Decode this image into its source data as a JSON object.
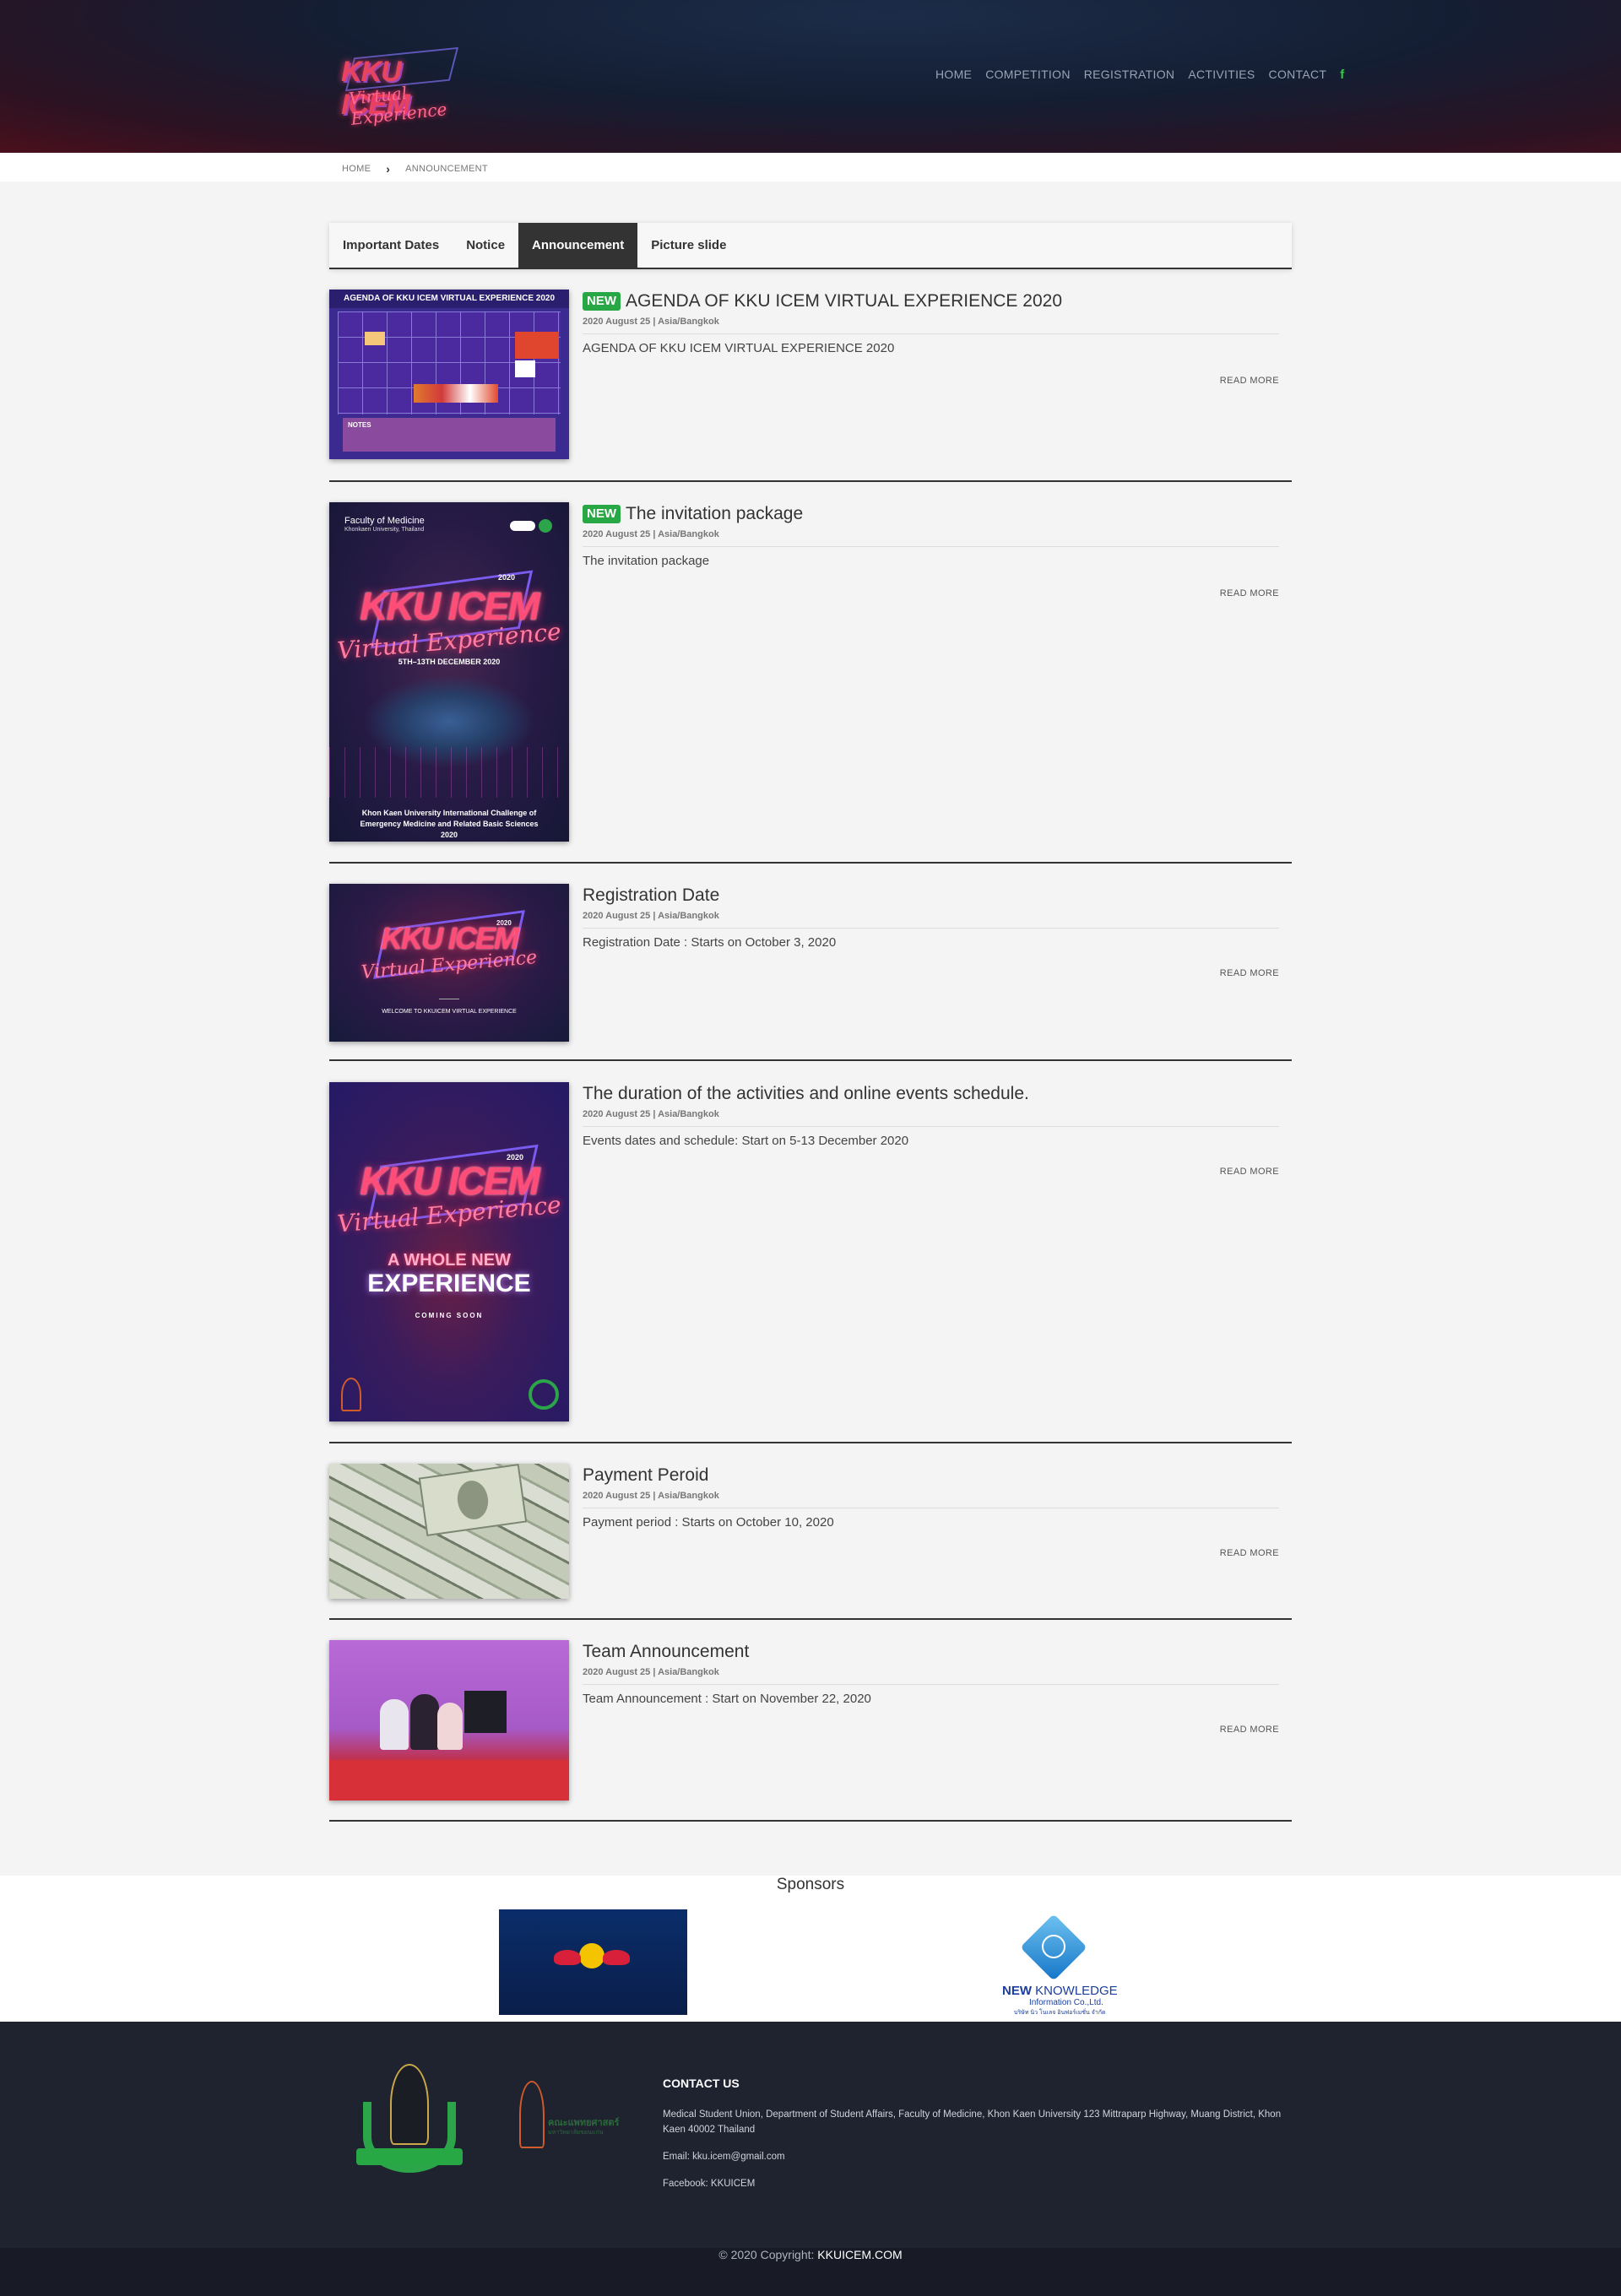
{
  "header": {
    "logo_line1": "KKU ICEM",
    "logo_line2": "Virtual Experience",
    "nav": [
      "HOME",
      "COMPETITION",
      "REGISTRATION",
      "ACTIVITIES",
      "CONTACT"
    ],
    "facebook_glyph": "f"
  },
  "breadcrumb": {
    "home": "HOME",
    "current": "ANNOUNCEMENT"
  },
  "tabs": [
    "Important Dates",
    "Notice",
    "Announcement",
    "Picture slide"
  ],
  "active_tab": "Announcement",
  "items": [
    {
      "badge": "NEW",
      "title": "AGENDA OF KKU ICEM VIRTUAL EXPERIENCE 2020",
      "meta": "2020 August 25 | Asia/Bangkok",
      "desc": "AGENDA OF KKU ICEM VIRTUAL EXPERIENCE 2020",
      "more": "READ MORE",
      "thumb_title": "AGENDA OF KKU ICEM VIRTUAL EXPERIENCE 2020",
      "thumb_notes": "NOTES"
    },
    {
      "badge": "NEW",
      "title": "The invitation package",
      "meta": "2020 August 25 | Asia/Bangkok",
      "desc": "The invitation package",
      "more": "READ MORE",
      "thumb_faculty": "Faculty of Medicine",
      "thumb_univ": "Khonkaen University, Thailand",
      "thumb_dates": "5TH–13TH DECEMBER 2020",
      "thumb_footer": "Khon Kaen University International Challenge of Emergency Medicine and Related Basic Sciences 2020"
    },
    {
      "badge": "",
      "title": "Registration Date",
      "meta": "2020 August 25 | Asia/Bangkok",
      "desc": "Registration Date : Starts on October 3, 2020",
      "more": "READ MORE",
      "thumb_welcome": "WELCOME TO KKUICEM VIRTUAL EXPERIENCE"
    },
    {
      "badge": "",
      "title": "The duration of the activities and online events schedule.",
      "meta": "2020 August 25 | Asia/Bangkok",
      "desc": "Events dates and schedule: Start on 5-13 December 2020",
      "more": "READ MORE",
      "thumb_whole": "A WHOLE NEW",
      "thumb_exp": "EXPERIENCE",
      "thumb_soon": "COMING SOON"
    },
    {
      "badge": "",
      "title": "Payment Peroid",
      "meta": "2020 August 25 | Asia/Bangkok",
      "desc": "Payment period : Starts on October 10, 2020",
      "more": "READ MORE"
    },
    {
      "badge": "",
      "title": "Team Announcement",
      "meta": "2020 August 25 | Asia/Bangkok",
      "desc": "Team Announcement : Start on November 22, 2020",
      "more": "READ MORE"
    }
  ],
  "poster": {
    "year": "2020",
    "kku": "KKU ICEM",
    "virtual": "Virtual Experience"
  },
  "sponsors": {
    "heading": "Sponsors",
    "nk_line1a": "NEW",
    "nk_line1b": "KNOWLEDGE",
    "nk_line2": "Information Co.,Ltd.",
    "nk_line3": "บริษัท นิว โนเลจ อินฟอร์เมชั่น จำกัด"
  },
  "footer": {
    "lamp_text": "คณะแพทยศาสตร์",
    "lamp_sub": "มหาวิทยาลัยขอนแก่น",
    "contact_heading": "CONTACT US",
    "address": "Medical Student Union, Department of Student Affairs, Faculty of Medicine, Khon Kaen University 123 Mittraparp Highway, Muang District, Khon Kaen 40002 Thailand",
    "email": "Email: kku.icem@gmail.com",
    "facebook": "Facebook: KKUICEM",
    "copyright": "© 2020 Copyright:",
    "copyright_site": "KKUICEM.COM"
  },
  "colors": {
    "new_badge": "#27a844",
    "footer_bg": "#1f2330",
    "active_tab": "#333333"
  }
}
